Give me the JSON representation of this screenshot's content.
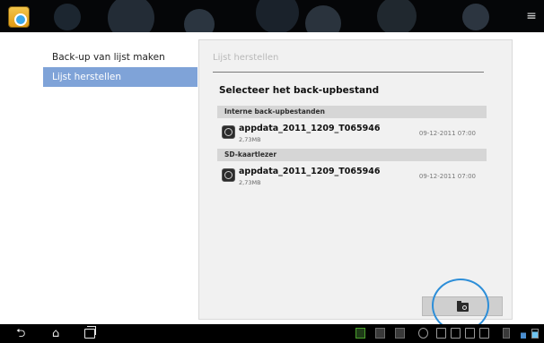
{
  "actionbar": {
    "app_icon": "backup-restore-app-icon",
    "menu_icon": "overflow-menu-icon"
  },
  "nav": {
    "items": [
      {
        "label": "Back-up van lijst maken",
        "selected": false
      },
      {
        "label": "Lijst herstellen",
        "selected": true
      }
    ]
  },
  "panel": {
    "title": "Lijst herstellen",
    "heading": "Selecteer het back-upbestand",
    "sections": [
      {
        "header": "Interne back-upbestanden",
        "files": [
          {
            "name": "appdata_2011_1209_T065946",
            "size": "2,73MB",
            "date": "09-12-2011 07:00"
          }
        ]
      },
      {
        "header": "SD-kaartlezer",
        "files": [
          {
            "name": "appdata_2011_1209_T065946",
            "size": "2,73MB",
            "date": "09-12-2011 07:00"
          }
        ]
      }
    ],
    "restore_button_icon": "folder-search-icon"
  },
  "systembar": {
    "icons": [
      "back-icon",
      "home-icon",
      "recent-apps-icon"
    ]
  },
  "colors": {
    "selected_nav": "#7fa3d8",
    "highlight_circle": "#2d8ed8"
  }
}
